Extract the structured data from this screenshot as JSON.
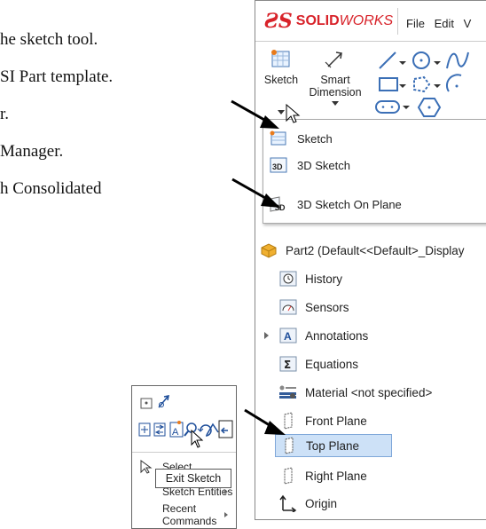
{
  "doc_lines": [
    "he sketch tool.",
    "SI Part template.",
    "r.",
    "Manager.",
    "h Consolidated"
  ],
  "app": {
    "logo_ds": "ƧS",
    "logo_solid": "SOLID",
    "logo_works": "WORKS",
    "menus": [
      "File",
      "Edit",
      "V"
    ]
  },
  "toolbar": {
    "sketch_label": "Sketch",
    "smart_label_1": "Smart",
    "smart_label_2": "Dimension"
  },
  "dropdown": {
    "items": [
      "Sketch",
      "3D Sketch",
      "3D Sketch On Plane"
    ]
  },
  "tree": {
    "part": "Part2  (Default<<Default>_Display",
    "items": [
      "History",
      "Sensors",
      "Annotations",
      "Equations",
      "Material <not specified>",
      "Front Plane",
      "Top Plane",
      "Right Plane",
      "Origin"
    ]
  },
  "context_menu": {
    "items": [
      "Select",
      "Sketch Entities",
      "Recent Commands"
    ],
    "tooltip": "Exit Sketch"
  },
  "colors": {
    "brand_red": "#d8232a",
    "selection": "#cde1f7",
    "selection_border": "#7fa7d9"
  }
}
